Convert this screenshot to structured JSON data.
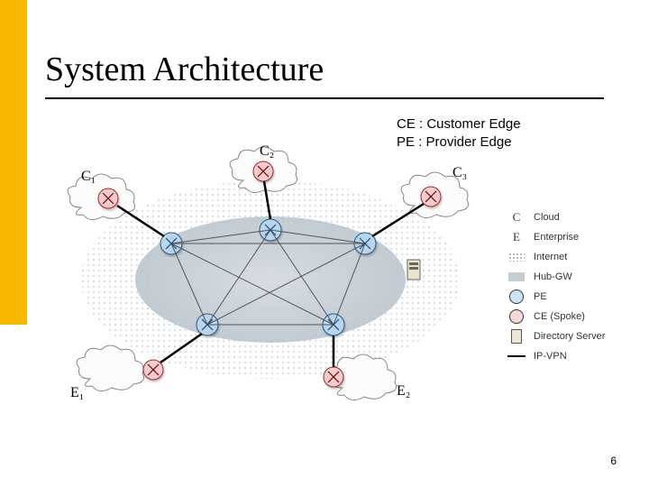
{
  "title": "System Architecture",
  "legend_top": {
    "ce": "CE : Customer Edge",
    "pe": "PE : Provider Edge"
  },
  "page_number": "6",
  "nodes": {
    "C1": "C₁",
    "C2": "C₂",
    "C3": "C₃",
    "E1": "E₁",
    "E2": "E₂"
  },
  "legend_right": {
    "cloud": "Cloud",
    "enterprise": "Enterprise",
    "internet": "Internet",
    "hub": "Hub-GW",
    "pe": "PE",
    "ce": "CE (Spoke)",
    "ds": "Directory Server",
    "ipvpn": "IP-VPN"
  },
  "chart_data": {
    "type": "diagram",
    "title": "System Architecture",
    "clouds": [
      {
        "id": "C1",
        "kind": "cloud",
        "pos": "upper-left"
      },
      {
        "id": "C2",
        "kind": "cloud",
        "pos": "top-center"
      },
      {
        "id": "C3",
        "kind": "cloud",
        "pos": "upper-right"
      },
      {
        "id": "E1",
        "kind": "enterprise",
        "pos": "lower-left"
      },
      {
        "id": "E2",
        "kind": "enterprise",
        "pos": "lower-right"
      }
    ],
    "ce_routers": [
      "CE_C1",
      "CE_C2",
      "CE_C3",
      "CE_E1",
      "CE_E2"
    ],
    "pe_routers": [
      "PE1",
      "PE2",
      "PE3",
      "PE4",
      "PE5"
    ],
    "hub_gw_region": true,
    "internet_region": true,
    "directory_server": true,
    "ip_vpn_links": [
      [
        "CE_C1",
        "PE1"
      ],
      [
        "CE_C2",
        "PE2"
      ],
      [
        "CE_C3",
        "PE3"
      ],
      [
        "CE_E1",
        "PE4"
      ],
      [
        "CE_E2",
        "PE5"
      ]
    ],
    "hub_full_mesh": [
      [
        "PE1",
        "PE2"
      ],
      [
        "PE1",
        "PE3"
      ],
      [
        "PE1",
        "PE4"
      ],
      [
        "PE1",
        "PE5"
      ],
      [
        "PE2",
        "PE3"
      ],
      [
        "PE2",
        "PE4"
      ],
      [
        "PE2",
        "PE5"
      ],
      [
        "PE3",
        "PE4"
      ],
      [
        "PE3",
        "PE5"
      ],
      [
        "PE4",
        "PE5"
      ]
    ]
  }
}
